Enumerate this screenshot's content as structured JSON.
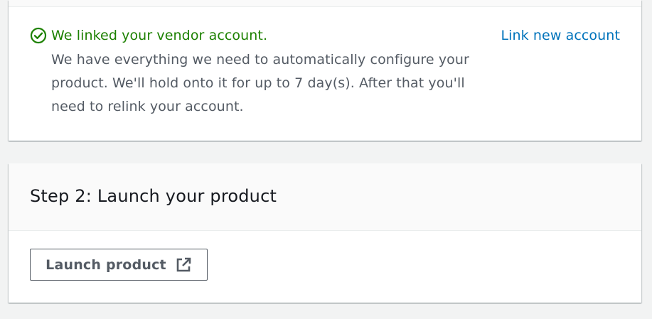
{
  "vendor_card": {
    "success_title": "We linked your vendor account.",
    "success_body": "We have everything we need to automatically configure your product. We'll hold onto it for up to 7 day(s). After that you'll need to relink your account.",
    "link_new_account": "Link new account",
    "success_icon": "check-circle-icon",
    "colors": {
      "success": "#1d8102",
      "link": "#0073bb",
      "body_text": "#545b64"
    }
  },
  "step2_card": {
    "title": "Step 2: Launch your product",
    "launch_button_label": "Launch product",
    "launch_button_icon": "external-link-icon"
  }
}
